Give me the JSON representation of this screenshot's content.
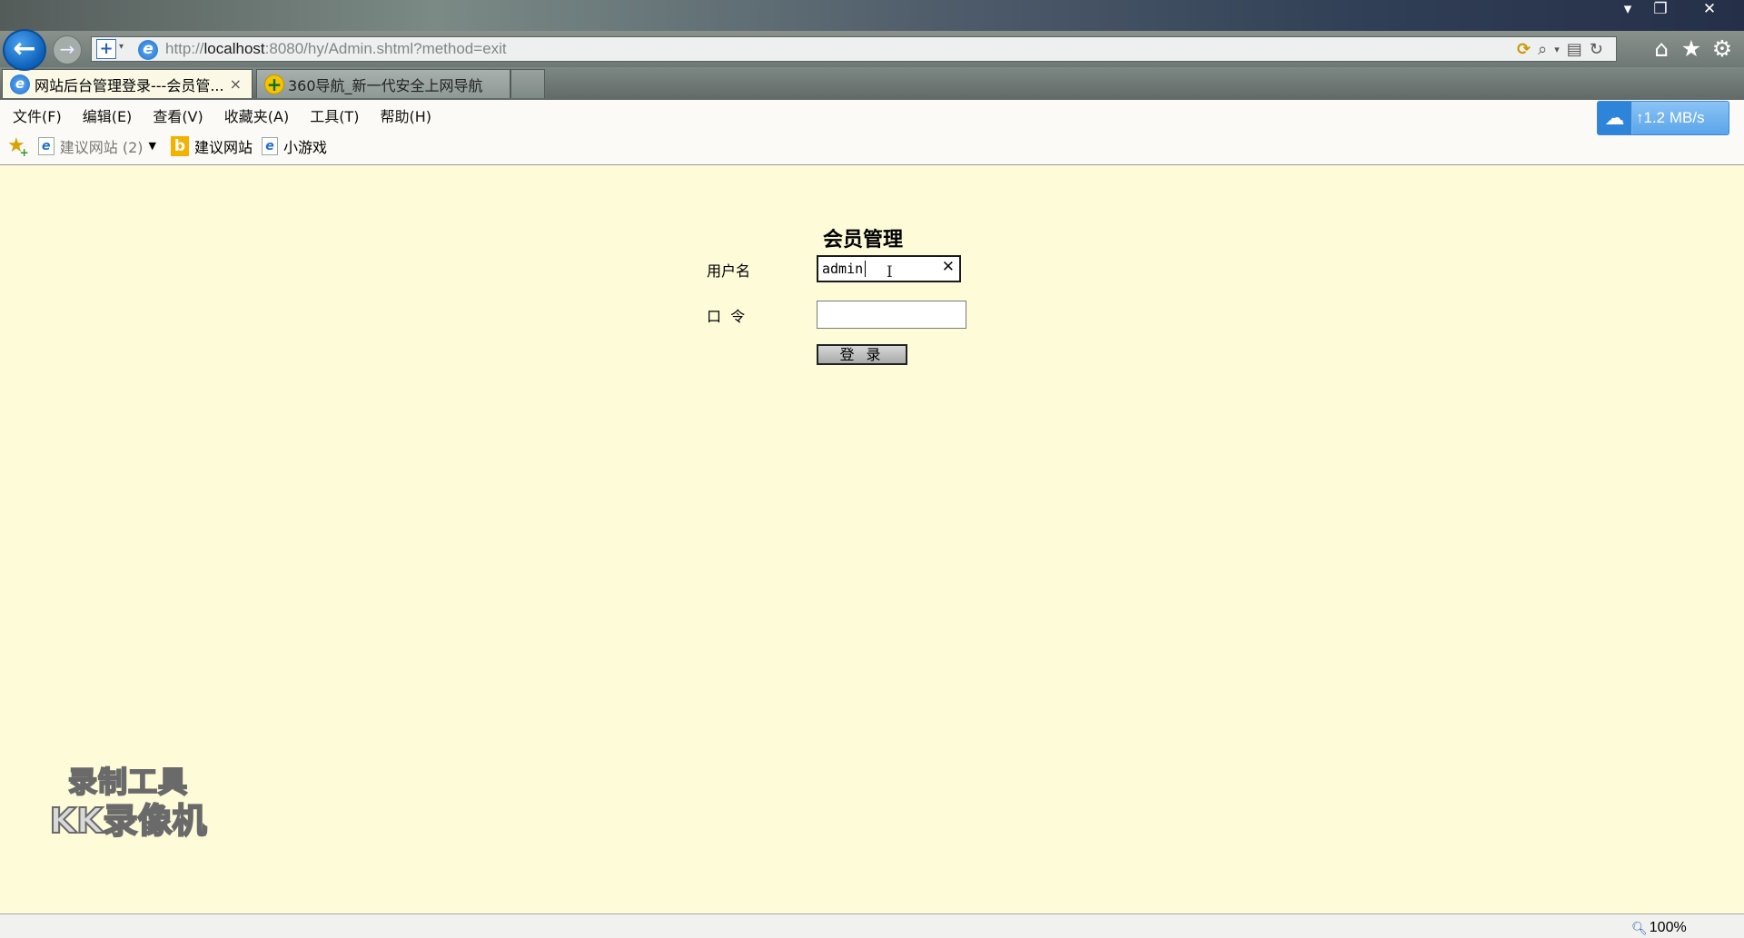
{
  "browser": {
    "address": {
      "url_prefix": "http://",
      "url_host": "localhost",
      "url_rest": ":8080/hy/Admin.shtml?method=exit"
    },
    "tabs": [
      {
        "title": "网站后台管理登录---会员管...",
        "close": "×",
        "active": true
      },
      {
        "title": "360导航_新一代安全上网导航",
        "active": false
      }
    ],
    "menu": [
      "文件(F)",
      "编辑(E)",
      "查看(V)",
      "收藏夹(A)",
      "工具(T)",
      "帮助(H)"
    ],
    "favorites": [
      {
        "label": "建议网站 (2)",
        "icon": "ie-page-icon",
        "has_dropdown": true
      },
      {
        "label": "建议网站",
        "icon": "bing-icon"
      },
      {
        "label": "小游戏",
        "icon": "ie-page-icon"
      }
    ],
    "speed_badge": "1.2 MB/s",
    "zoom": "100%"
  },
  "form": {
    "title": "会员管理",
    "username_label": "用户名",
    "username_value": "admin",
    "password_label": "口  令",
    "password_value": "",
    "submit_label": "登 录"
  },
  "watermark": {
    "line1": "录制工具",
    "line2": "KK录像机"
  },
  "colors": {
    "page_background": "#fdfbd8",
    "speed_badge": "#5aa5ea"
  }
}
